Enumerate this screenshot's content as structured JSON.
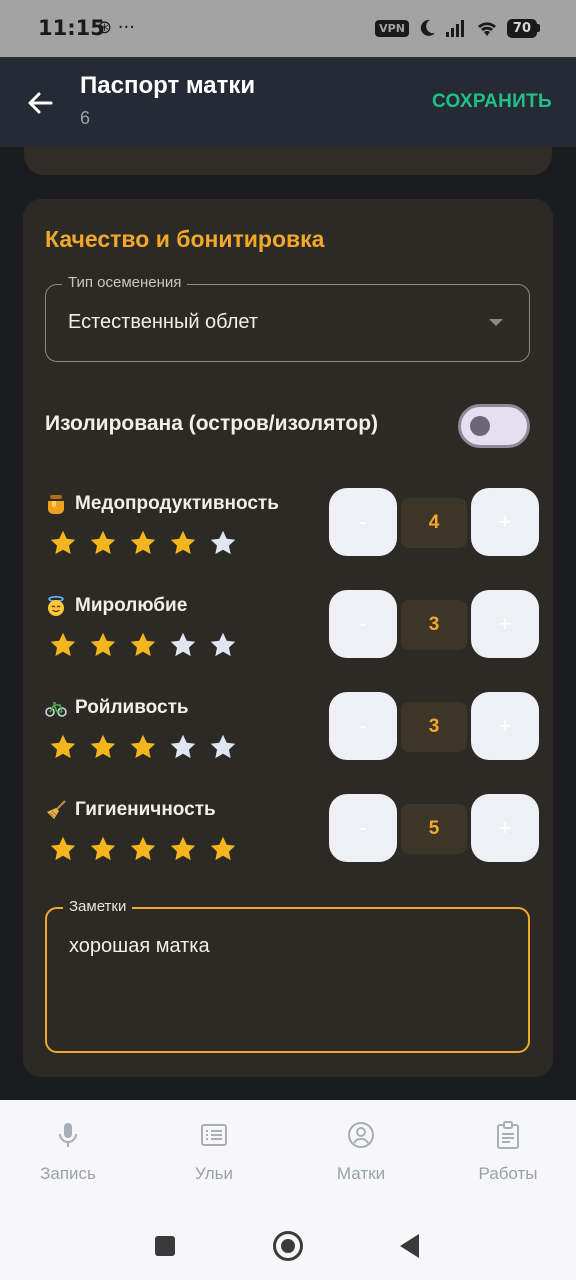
{
  "status_bar": {
    "time": "11:15",
    "left_icons": "⊛ ···",
    "vpn": "VPN",
    "battery": "70"
  },
  "app_bar": {
    "title": "Паспорт матки",
    "subtitle": "6",
    "save_label": "СОХРАНИТЬ"
  },
  "card": {
    "title": "Качество и бонитировка",
    "insemination": {
      "label": "Тип осеменения",
      "value": "Естественный облет"
    },
    "isolated": {
      "label": "Изолирована (остров/изолятор)",
      "checked": false
    },
    "traits": [
      {
        "emoji": "honey-pot-icon",
        "name": "Медопродуктивность",
        "value": "4",
        "rating": 4,
        "max": 5,
        "minus": "-",
        "plus": "+"
      },
      {
        "emoji": "angel-face-icon",
        "name": "Миролюбие",
        "value": "3",
        "rating": 3,
        "max": 5,
        "minus": "-",
        "plus": "+"
      },
      {
        "emoji": "bicycle-icon",
        "name": "Ройливость",
        "value": "3",
        "rating": 3,
        "max": 5,
        "minus": "-",
        "plus": "+"
      },
      {
        "emoji": "broom-icon",
        "name": "Гигиеничность",
        "value": "5",
        "rating": 5,
        "max": 5,
        "minus": "-",
        "plus": "+"
      }
    ],
    "notes": {
      "label": "Заметки",
      "value": "хорошая матка"
    }
  },
  "bottom_nav": {
    "items": [
      {
        "icon": "microphone-icon",
        "label": "Запись"
      },
      {
        "icon": "list-icon",
        "label": "Ульи"
      },
      {
        "icon": "account-circle-icon",
        "label": "Матки"
      },
      {
        "icon": "clipboard-icon",
        "label": "Работы"
      }
    ]
  },
  "colors": {
    "accent": "#f3a72b",
    "save": "#1fc08a",
    "star_filled": "#f5b51d",
    "star_empty": "#dfe6f2"
  }
}
